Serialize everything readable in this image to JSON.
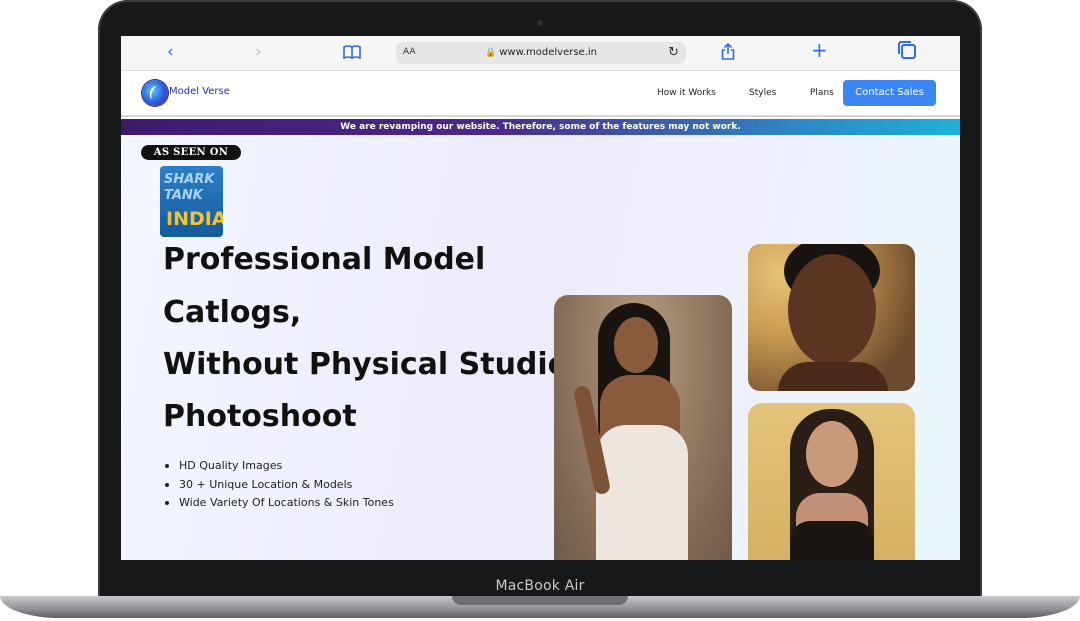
{
  "browser": {
    "text_size_label": "AA",
    "url": "www.modelverse.in"
  },
  "site": {
    "brand": "Model Verse",
    "nav": [
      {
        "label": "How it Works"
      },
      {
        "label": "Styles"
      },
      {
        "label": "Plans"
      }
    ],
    "cta_label": "Contact Sales"
  },
  "banner": {
    "text": "We are revamping our website. Therefore, some of the features may not work."
  },
  "hero": {
    "seen_on": "AS SEEN ON",
    "logo_lines": [
      "SHARK",
      "TANK",
      "INDIA"
    ],
    "headline_lines": [
      "Professional Model",
      "Catlogs,",
      "Without Physical Studio",
      "Photoshoot"
    ],
    "bullets": [
      "HD Quality Images",
      "30 + Unique Location & Models",
      "Wide Variety Of Locations & Skin Tones"
    ]
  },
  "device": {
    "label": "MacBook Air"
  },
  "colors": {
    "accent": "#3a86f2",
    "brand_text": "#2b2bb0",
    "banner_start": "#3e1a6e",
    "banner_end": "#1fb0d6"
  }
}
